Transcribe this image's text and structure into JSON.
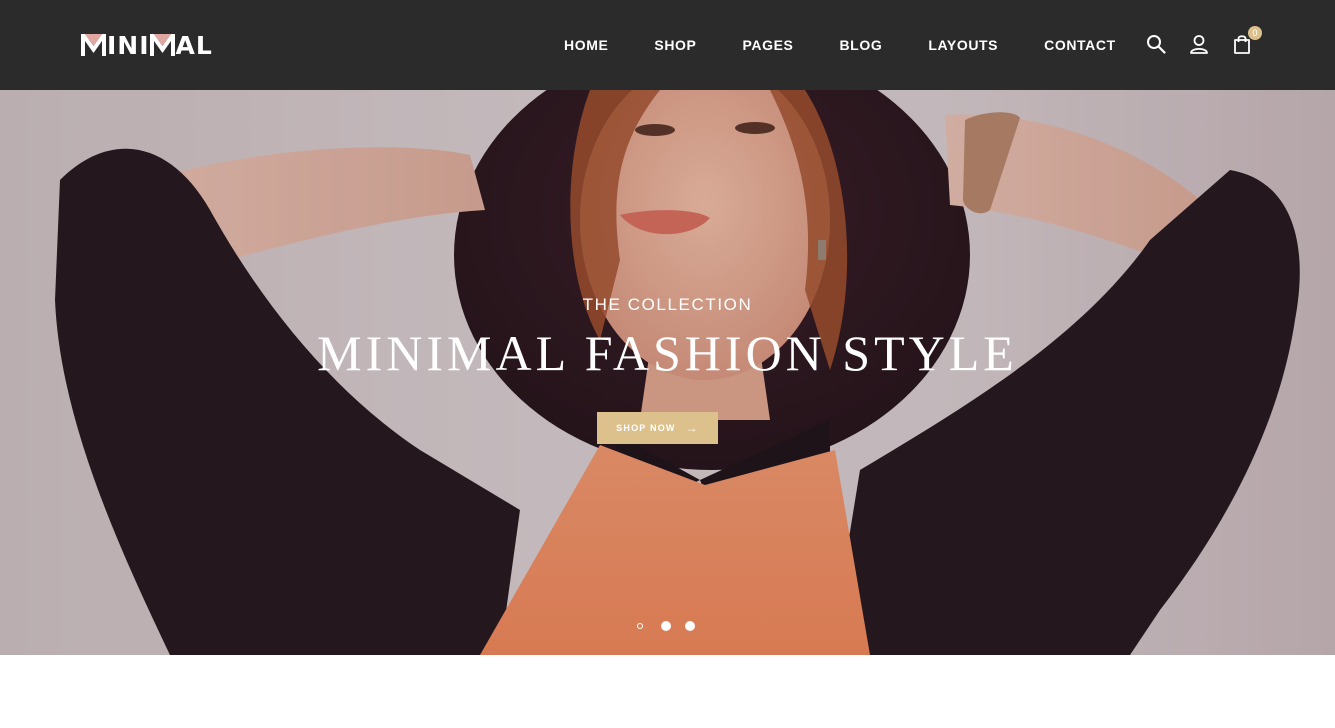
{
  "brand": {
    "logo_parts": [
      "M",
      "INI",
      "M",
      "AL"
    ],
    "accent_color": "#e0a8a0"
  },
  "nav": {
    "items": [
      {
        "label": "HOME"
      },
      {
        "label": "SHOP"
      },
      {
        "label": "PAGES"
      },
      {
        "label": "BLOG"
      },
      {
        "label": "LAYOUTS"
      },
      {
        "label": "CONTACT"
      }
    ]
  },
  "header_icons": {
    "search": "search-icon",
    "account": "user-icon",
    "cart": "shopping-bag-icon",
    "cart_count": "0"
  },
  "hero": {
    "subtitle": "THE COLLECTION",
    "title": "MINIMAL FASHION STYLE",
    "cta_label": "SHOP NOW",
    "cta_icon": "arrow-right-icon",
    "cta_color": "#dcc18c",
    "slides_total": 3,
    "active_slide": 1
  },
  "colors": {
    "header_bg": "#2b2b2b",
    "accent": "#dcc18c"
  }
}
